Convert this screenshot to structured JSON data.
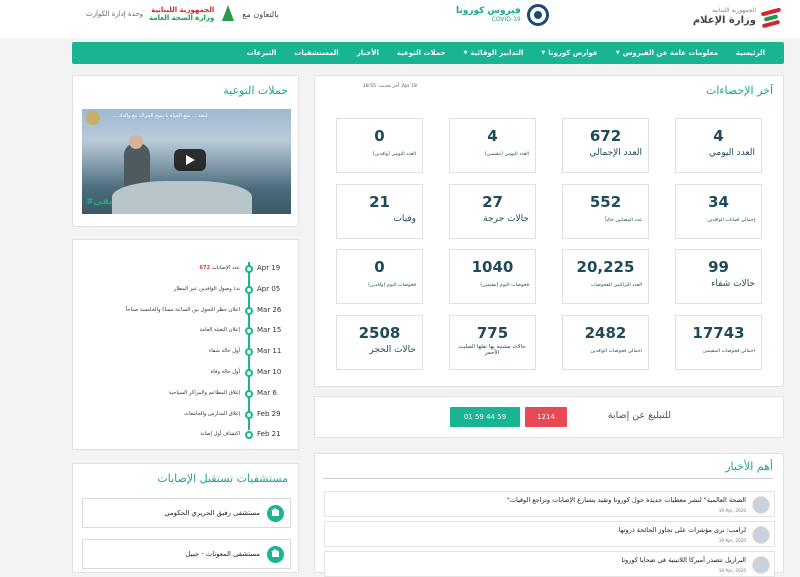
{
  "header": {
    "ministry_top": "الجمهورية اللبنانية",
    "ministry_name": "وزارة الإعلام",
    "covid_title": "فيروس كورونا",
    "covid_sub": "COVID-19",
    "collab_label": "بالتعاون مع",
    "moh_top": "الجمهورية اللبنانية",
    "moh_name": "وزارة الصحة العامة",
    "crisis_unit": "وحدة إدارة الكوارث"
  },
  "nav": [
    {
      "label": "الرئيسية",
      "caret": false
    },
    {
      "label": "معلومات عامة عن الفيروس",
      "caret": true
    },
    {
      "label": "عوارض كورونا",
      "caret": true
    },
    {
      "label": "التدابير الوقائية",
      "caret": true
    },
    {
      "label": "حملات التوعية",
      "caret": false
    },
    {
      "label": "الأخبار",
      "caret": false
    },
    {
      "label": "المستشفيات",
      "caret": false
    },
    {
      "label": "التبرعات",
      "caret": false
    }
  ],
  "stats": {
    "title": "آخر الإحصاءات",
    "last_update": "آخر تحديث: 18:55 ,Apr 18",
    "boxes": [
      {
        "value": "4",
        "label": "العدد اليومي"
      },
      {
        "value": "672",
        "label": "العدد الإجمالي"
      },
      {
        "value": "4",
        "label": "العدد اليومي (مقيمين)"
      },
      {
        "value": "0",
        "label": "العدد اليومي (وافدين)"
      },
      {
        "value": "34",
        "label": "إجمالي اصابات الوافدين"
      },
      {
        "value": "552",
        "label": "عدد المصابين حالياً"
      },
      {
        "value": "27",
        "label": "حالات حرجة"
      },
      {
        "value": "21",
        "label": "وفيات"
      },
      {
        "value": "99",
        "label": "حالات شفاء"
      },
      {
        "value": "20,225",
        "label": "العدد التراكمي للفحوصات"
      },
      {
        "value": "1040",
        "label": "فحوصات اليوم (مقيمين)"
      },
      {
        "value": "0",
        "label": "فحوصات اليوم (وافدين)"
      },
      {
        "value": "17743",
        "label": "اجمالي فحوصات المقيمين"
      },
      {
        "value": "2482",
        "label": "اجمالي فحوصات الوافدين"
      },
      {
        "value": "775",
        "label": "حالات مشتبه بها نقلها الصليب الأحمر"
      },
      {
        "value": "2508",
        "label": "حالات الحجر"
      }
    ]
  },
  "report": {
    "label": "للتبليغ عن إصابة",
    "hotline_red": "1214",
    "hotline_green": "01 59 44 59"
  },
  "news": {
    "title": "أهم الأخبار",
    "items": [
      {
        "headline": "\"الصحة العالمية\" لنشر معطيات جديدة حول كورونا وتقيد بتسارع الإصابات وتراجع الوفيات",
        "date": "19 Apr, 2020"
      },
      {
        "headline": "لرامب: نرى مؤشرات على تجاوز الجائحة ذروتها",
        "date": "19 Apr, 2020"
      },
      {
        "headline": "البرازيل تتصدر أميركا اللاتينية في ضحايا كورونا",
        "date": "19 Apr, 2020"
      }
    ]
  },
  "campaigns": {
    "title": "حملات التوعية",
    "video_title": "... ابتعد ... متع الحياة يا شيخ الحراك مع والدك",
    "video_tag": "#بقى"
  },
  "timeline": {
    "items": [
      {
        "date": "Apr 19",
        "text": "عدد الإصابات",
        "highlight": "672"
      },
      {
        "date": "Apr 05",
        "text": "بدء وصول الوافدين عبر المطار",
        "highlight": ""
      },
      {
        "date": "Mar 26",
        "text": "اعلان حظر التجول بين الساعة مساءً والخامسة صباحاً",
        "highlight": ""
      },
      {
        "date": "Mar 15",
        "text": "إعلان التعبئة العامة",
        "highlight": ""
      },
      {
        "date": "Mar 11",
        "text": "أول حالة شفاء",
        "highlight": ""
      },
      {
        "date": "Mar 10",
        "text": "أول حالة وفاة",
        "highlight": ""
      },
      {
        "date": "Mar 6",
        "text": "إغلاق المطاعم والمراكز السياحية",
        "highlight": ""
      },
      {
        "date": "Feb 29",
        "text": "إغلاق المدارس والجامعات",
        "highlight": ""
      },
      {
        "date": "Feb 21",
        "text": "اكتشاف أول إصابة",
        "highlight": ""
      }
    ]
  },
  "hospitals": {
    "title": "مستشفيات تستقبل الإصابات",
    "items": [
      {
        "name": "مستشفى رفيق الحريري الحكومي"
      },
      {
        "name": "مستشفى المعونات - جبيل"
      }
    ]
  },
  "colors": {
    "accent": "#19b492",
    "title": "#1fa68a",
    "hotline_red": "#e84a55",
    "stat_text": "#1f4a5a"
  }
}
